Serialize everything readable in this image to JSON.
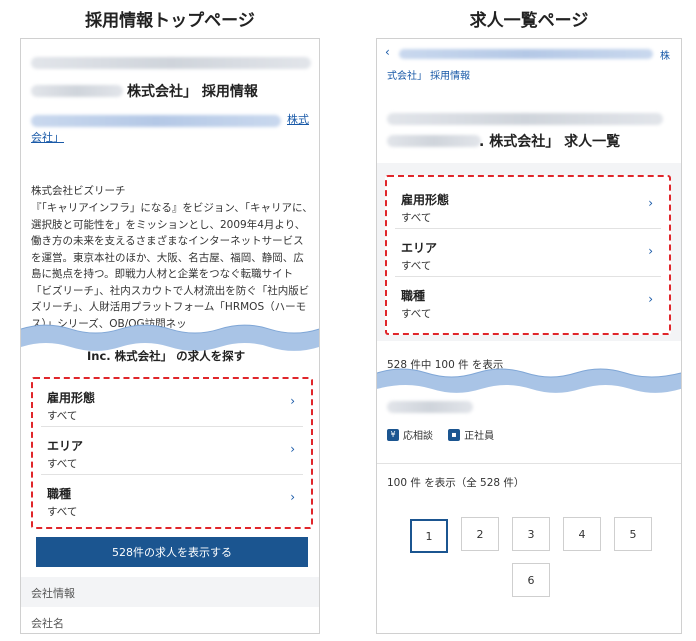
{
  "captions": {
    "left": "採用情報トップページ",
    "right": "求人一覧ページ"
  },
  "left": {
    "link_tail_1": "株式",
    "link_tail_2": "会社」",
    "title_suffix": "株式会社」 採用情報",
    "company_name": "株式会社ビズリーチ",
    "description": "『「キャリアインフラ」になる』をビジョン、「キャリアに、選択肢と可能性を」をミッションとし、2009年4月より、働き方の未来を支えるさまざまなインターネットサービスを運営。東京本社のほか、大阪、名古屋、福岡、静岡、広島に拠点を持つ。即戦力人材と企業をつなぐ転職サイト「ビズリーチ」、社内スカウトで人材流出を防ぐ「社内版ビズリーチ」、人財活用プラットフォーム「HRMOS（ハーモス）」シリーズ、OB/OG訪問ネッ",
    "search_heading": "Inc. 株式会社」 の求人を探す",
    "filters": [
      {
        "label": "雇用形態",
        "value": "すべて"
      },
      {
        "label": "エリア",
        "value": "すべて"
      },
      {
        "label": "職種",
        "value": "すべて"
      }
    ],
    "show_button": "528件の求人を表示する",
    "company_info_heading": "会社情報",
    "company_name_label": "会社名"
  },
  "right": {
    "back_chevron": "‹",
    "breadcrumb_tail": "株",
    "breadcrumb_line2": "式会社」 採用情報",
    "title_suffix": ". 株式会社」 求人一覧",
    "filters": [
      {
        "label": "雇用形態",
        "value": "すべて"
      },
      {
        "label": "エリア",
        "value": "すべて"
      },
      {
        "label": "職種",
        "value": "すべて"
      }
    ],
    "result_count": "528 件中 100 件 を表示",
    "tags": [
      {
        "icon": "¥",
        "text": "応相談"
      },
      {
        "icon": "▪",
        "text": "正社員"
      }
    ],
    "pagination_summary": "100 件 を表示（全 528 件）",
    "pages": [
      "1",
      "2",
      "3",
      "4",
      "5",
      "6"
    ],
    "active_page": "1"
  },
  "colors": {
    "accent": "#1b5590",
    "link": "#1a5aa8",
    "highlight": "#e0262b",
    "wave": "#a9c4e6"
  }
}
